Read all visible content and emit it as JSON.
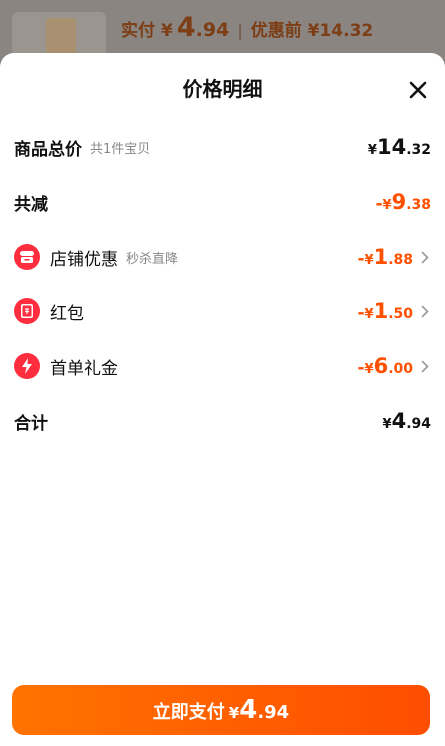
{
  "background": {
    "price_label": "实付",
    "yen": "¥",
    "price_int": "4",
    "price_dec": ".94",
    "separator": "|",
    "original_price": "优惠前 ¥14.32"
  },
  "sheet": {
    "title": "价格明细",
    "close_icon": "close-icon",
    "rows": [
      {
        "label": "商品总价",
        "note": "共1件宝贝",
        "yen": "¥",
        "int": "14",
        "dec": ".32",
        "prefix": ""
      },
      {
        "label": "共减",
        "note": "",
        "yen": "¥",
        "int": "9",
        "dec": ".38",
        "prefix": "-"
      },
      {
        "label": "店铺优惠",
        "note": "秒杀直降",
        "yen": "¥",
        "int": "1",
        "dec": ".88",
        "prefix": "-",
        "icon": "shop-icon"
      },
      {
        "label": "红包",
        "note": "",
        "yen": "¥",
        "int": "1",
        "dec": ".50",
        "prefix": "-",
        "icon": "red-packet-icon"
      },
      {
        "label": "首单礼金",
        "note": "",
        "yen": "¥",
        "int": "6",
        "dec": ".00",
        "prefix": "-",
        "icon": "lightning-icon"
      },
      {
        "label": "合计",
        "note": "",
        "yen": "¥",
        "int": "4",
        "dec": ".94",
        "prefix": ""
      }
    ]
  },
  "pay_button": {
    "label": "立即支付",
    "yen": "¥",
    "int": "4",
    "dec": ".94"
  },
  "colors": {
    "accent": "#ff5000",
    "icon_red": "#ff2d3d"
  }
}
